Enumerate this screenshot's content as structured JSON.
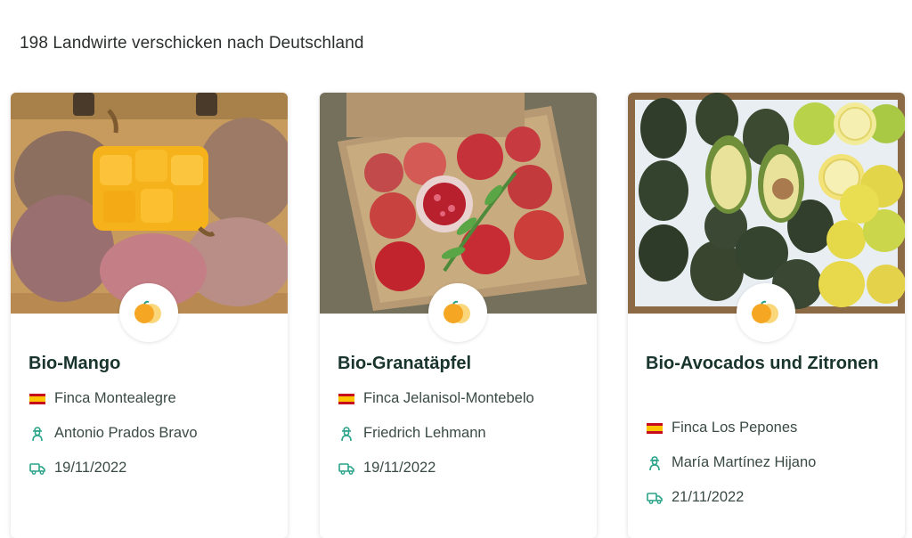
{
  "headline": "198 Landwirte verschicken nach Deutschland",
  "cards": [
    {
      "title": "Bio-Mango",
      "farm": "Finca Montealegre",
      "farmer": "Antonio Prados Bravo",
      "date": "19/11/2022"
    },
    {
      "title": "Bio-Granatäpfel",
      "farm": "Finca Jelanisol-Montebelo",
      "farmer": "Friedrich Lehmann",
      "date": "19/11/2022"
    },
    {
      "title": "Bio-Avocados und Zitronen",
      "farm": "Finca Los Pepones",
      "farmer": "María Martínez Hijano",
      "date": "21/11/2022"
    }
  ],
  "colors": {
    "accent": "#2aa389",
    "title": "#18342c",
    "badge_orange": "#f5a623"
  },
  "icons": {
    "flag": "spain-flag-icon",
    "farmer": "farmer-icon",
    "date": "delivery-truck-icon",
    "badge": "citrus-fruit-icon"
  }
}
